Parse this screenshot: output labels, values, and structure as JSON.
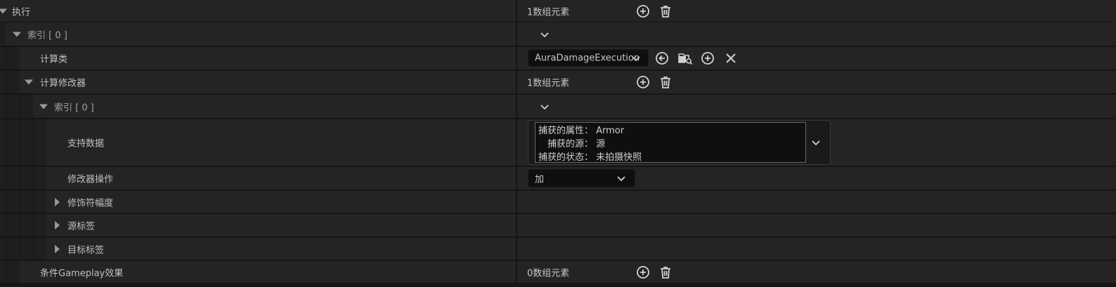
{
  "rows": {
    "execution": {
      "label": "执行",
      "value": "1数组元素"
    },
    "index0": {
      "label": "索引 [ 0 ]"
    },
    "calc_class": {
      "label": "计算类",
      "value": "AuraDamageExecution"
    },
    "calc_modifiers": {
      "label": "计算修改器",
      "value": "1数组元素"
    },
    "mod_index0": {
      "label": "索引 [ 0 ]"
    },
    "backing_data": {
      "label": "支持数据",
      "line1": "捕获的属性： Armor",
      "line2": "捕获的源： 源",
      "line3": "捕获的状态： 未拍摄快照"
    },
    "modifier_op": {
      "label": "修改器操作",
      "value": "加"
    },
    "modifier_magnitude": {
      "label": "修饰符幅度"
    },
    "source_tags": {
      "label": "源标签"
    },
    "target_tags": {
      "label": "目标标签"
    },
    "conditional_effects": {
      "label": "条件Gameplay效果",
      "value": "0数组元素"
    }
  },
  "icons": {
    "add": "plus-circle-icon",
    "delete": "trash-icon",
    "browse": "arrow-left-circle-icon",
    "find": "folder-search-icon",
    "clear": "x-icon",
    "dropdown": "chevron-down-icon",
    "expanded": "triangle-down-icon",
    "collapsed": "triangle-right-icon"
  },
  "colors": {
    "background": "#242424",
    "separator": "#151515",
    "field": "#0f0f0f",
    "text": "#c0c0c0"
  }
}
